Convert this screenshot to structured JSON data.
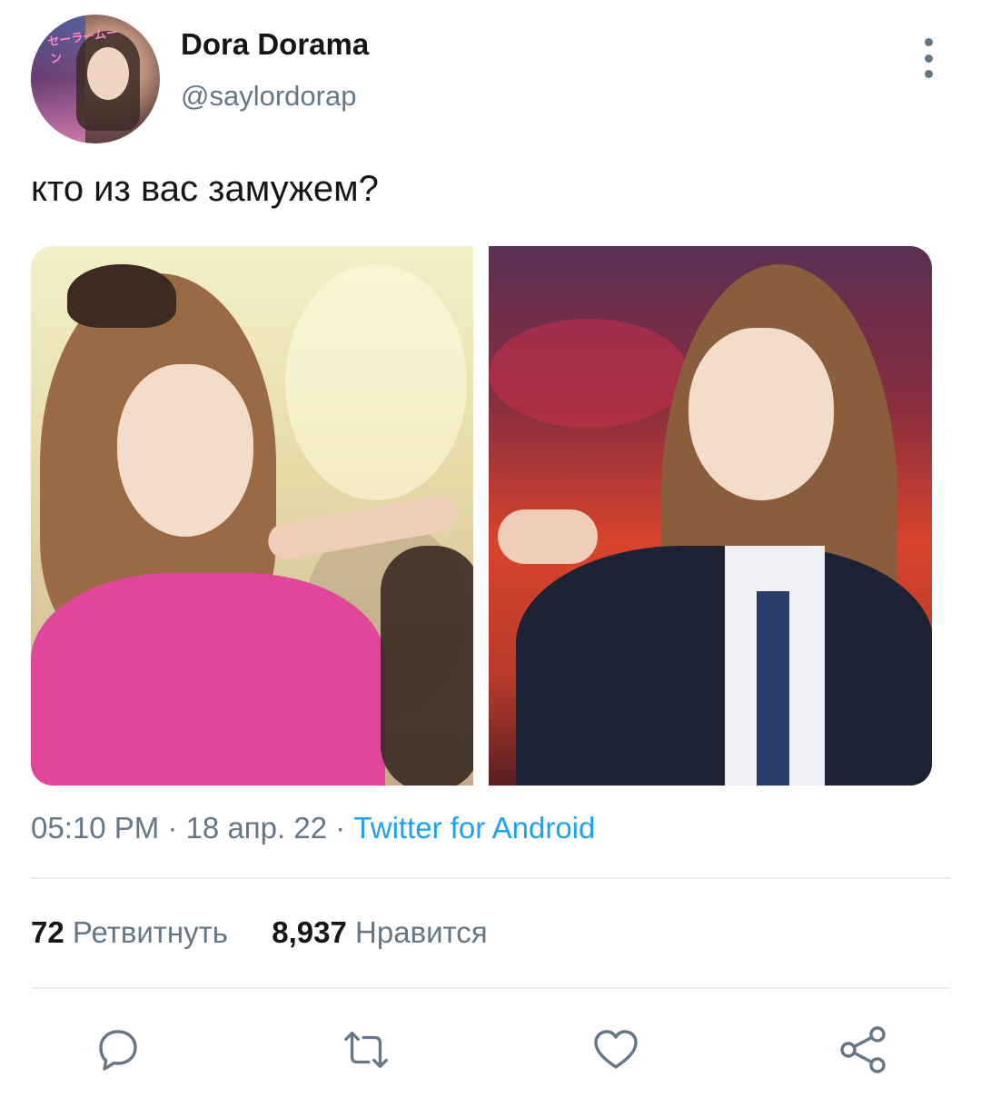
{
  "tweet": {
    "author": {
      "display_name": "Dora Dorama",
      "handle": "@saylordorap",
      "avatar_logo_text": "セーラームーン"
    },
    "text": "кто из вас замужем?",
    "meta": {
      "time": "05:10 PM",
      "separator1": " · ",
      "date": "18 апр. 22",
      "separator2": " · ",
      "source": "Twitter for Android"
    },
    "stats": {
      "retweets_count": "72",
      "retweets_label": "Ретвитнуть",
      "likes_count": "8,937",
      "likes_label": "Нравится"
    }
  },
  "icons": {
    "more": "more-vertical-icon",
    "reply": "reply-icon",
    "retweet": "retweet-icon",
    "like": "heart-icon",
    "share": "share-icon"
  },
  "colors": {
    "text_primary": "#14171a",
    "text_secondary": "#657786",
    "link_blue": "#1da1f2",
    "divider": "#e6ecf0"
  }
}
